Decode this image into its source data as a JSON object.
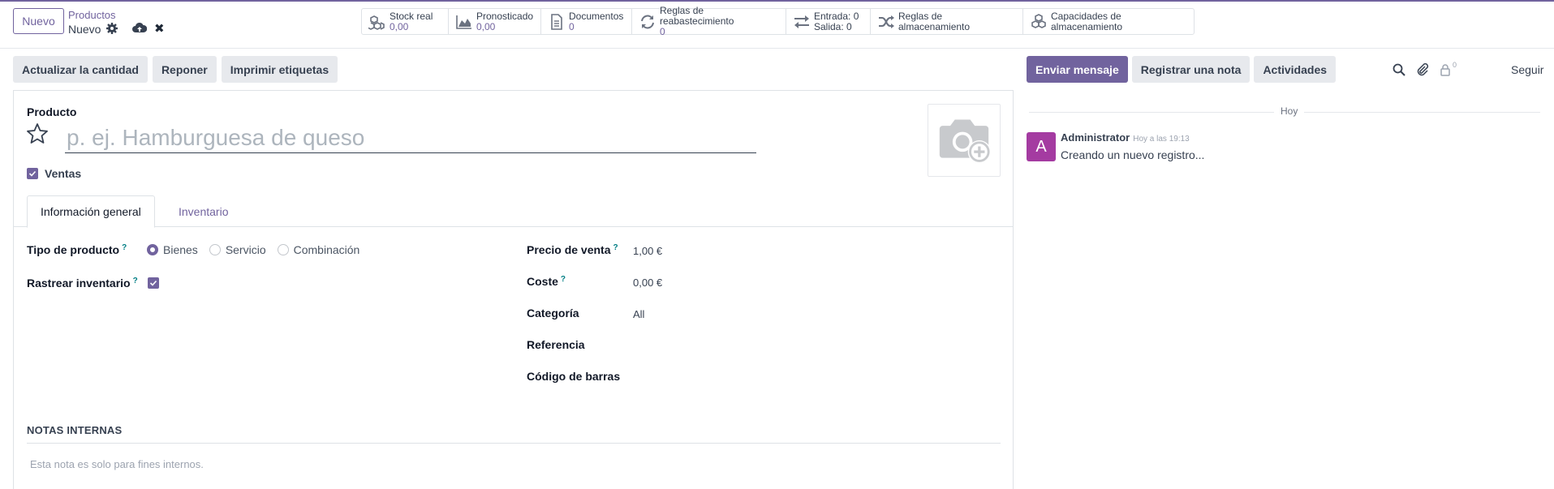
{
  "breadcrumb": {
    "new_label": "Nuevo",
    "parent": "Productos",
    "current": "Nuevo"
  },
  "smart_buttons": [
    {
      "icon": "cubes-icon",
      "label": "Stock real",
      "value": "0,00"
    },
    {
      "icon": "area-chart-icon",
      "label": "Pronosticado",
      "value": "0,00"
    },
    {
      "icon": "file-text-icon",
      "label": "Documentos",
      "value": "0"
    },
    {
      "icon": "refresh-icon",
      "label": "Reglas de reabastecimiento",
      "value": "0"
    },
    {
      "icon": "exchange-icon",
      "label1": "Entrada: 0",
      "label2": "Salida: 0"
    },
    {
      "icon": "random-icon",
      "label": "Reglas de almacenamiento"
    },
    {
      "icon": "cubes-icon",
      "label": "Capacidades de almacenamiento"
    }
  ],
  "actions": {
    "update_qty": "Actualizar la cantidad",
    "replenish": "Reponer",
    "print_labels": "Imprimir etiquetas"
  },
  "form": {
    "product_label": "Producto",
    "name_placeholder": "p. ej. Hamburguesa de queso",
    "sales_label": "Ventas",
    "tabs": [
      "Información general",
      "Inventario"
    ],
    "product_type_label": "Tipo de producto",
    "product_type_options": [
      "Bienes",
      "Servicio",
      "Combinación"
    ],
    "product_type_selected": "Bienes",
    "track_inventory_label": "Rastrear inventario",
    "sale_price_label": "Precio de venta",
    "sale_price_value": "1,00 €",
    "cost_label": "Coste",
    "cost_value": "0,00 €",
    "category_label": "Categoría",
    "category_value": "All",
    "reference_label": "Referencia",
    "barcode_label": "Código de barras",
    "help_mark": "?",
    "internal_notes_title": "NOTAS INTERNAS",
    "internal_notes_placeholder": "Esta nota es solo para fines internos."
  },
  "chatter": {
    "send_message": "Enviar mensaje",
    "log_note": "Registrar una nota",
    "activities": "Actividades",
    "followers_count": "0",
    "follow": "Seguir",
    "day": "Hoy",
    "message": {
      "avatar_letter": "A",
      "author": "Administrator",
      "date": "Hoy a las 19:13",
      "body": "Creando un nuevo registro..."
    }
  },
  "colors": {
    "accent": "#71639e",
    "avatar": "#a43ba1"
  }
}
